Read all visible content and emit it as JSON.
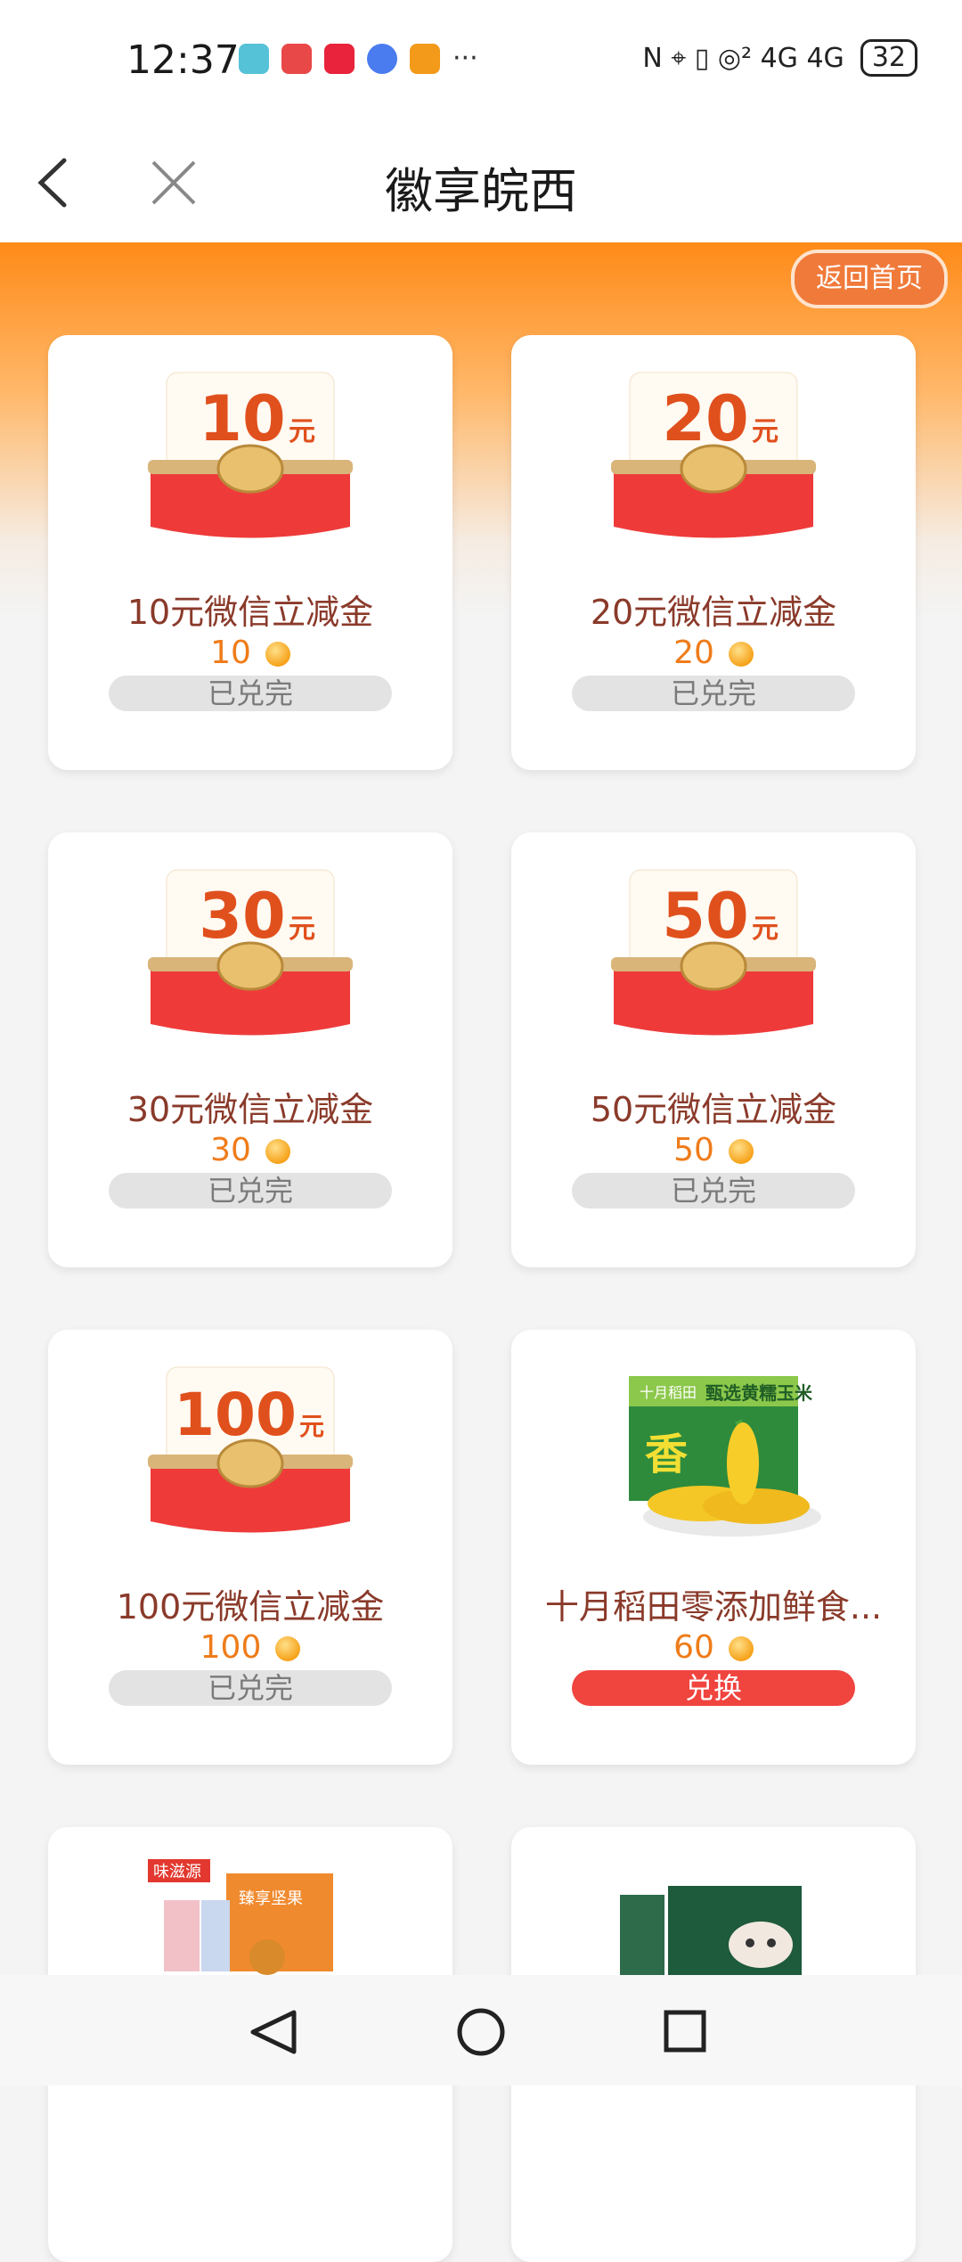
{
  "status": {
    "time": "12:37",
    "indicators": "N  ⌖  ▯  ◎²  4G  4G",
    "battery": "32"
  },
  "nav": {
    "title": "徽享皖西",
    "back_home": "返回首页"
  },
  "cards": [
    {
      "amount": "10",
      "unit": "元",
      "title": "10元微信立减金",
      "price": "10",
      "button": "已兑完",
      "type": "voucher"
    },
    {
      "amount": "20",
      "unit": "元",
      "title": "20元微信立减金",
      "price": "20",
      "button": "已兑完",
      "type": "voucher"
    },
    {
      "amount": "30",
      "unit": "元",
      "title": "30元微信立减金",
      "price": "30",
      "button": "已兑完",
      "type": "voucher"
    },
    {
      "amount": "50",
      "unit": "元",
      "title": "50元微信立减金",
      "price": "50",
      "button": "已兑完",
      "type": "voucher"
    },
    {
      "amount": "100",
      "unit": "元",
      "title": "100元微信立减金",
      "price": "100",
      "button": "已兑完",
      "type": "voucher"
    },
    {
      "title": "十月稻田零添加鲜食...",
      "price": "60",
      "button": "兑换",
      "type": "corn",
      "box_brand": "十月稻田",
      "box_text": "甄选黄糯玉米",
      "box_big": "香"
    },
    {
      "type": "snack",
      "box_brand": "味滋源",
      "box_text": "臻享坚果"
    },
    {
      "type": "milk"
    }
  ],
  "colors": {
    "accent": "#ff8a18",
    "title": "#8a3a2a",
    "price": "#ef7c1a",
    "redeem": "#f0443f"
  }
}
